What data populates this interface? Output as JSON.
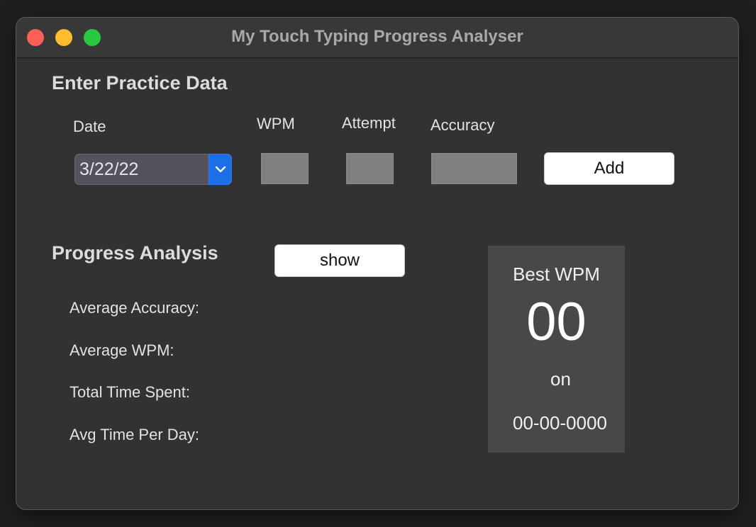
{
  "window": {
    "title": "My Touch Typing Progress Analyser"
  },
  "entry": {
    "section_title": "Enter Practice Data",
    "date_label": "Date",
    "wpm_label": "WPM",
    "attempt_label": "Attempt",
    "accuracy_label": "Accuracy",
    "date_value": "3/22/22",
    "wpm_value": "",
    "attempt_value": "",
    "accuracy_value": "",
    "add_label": "Add"
  },
  "analysis": {
    "section_title": "Progress Analysis",
    "show_label": "show",
    "avg_accuracy_label": "Average Accuracy:",
    "avg_wpm_label": "Average WPM:",
    "total_time_label": "Total Time Spent:",
    "avg_time_per_day_label": "Avg Time Per Day:"
  },
  "best": {
    "title": "Best WPM",
    "value": "00",
    "on_label": "on",
    "date": "00-00-0000"
  },
  "colors": {
    "window_bg": "#323232",
    "titlebar_bg": "#383838",
    "close": "#fe5f57",
    "minimize": "#febc2e",
    "maximize": "#28c840",
    "accent": "#1e6ee6",
    "panel_bg": "#484848"
  },
  "icons": {
    "date_stepper": "chevron-down-icon"
  }
}
